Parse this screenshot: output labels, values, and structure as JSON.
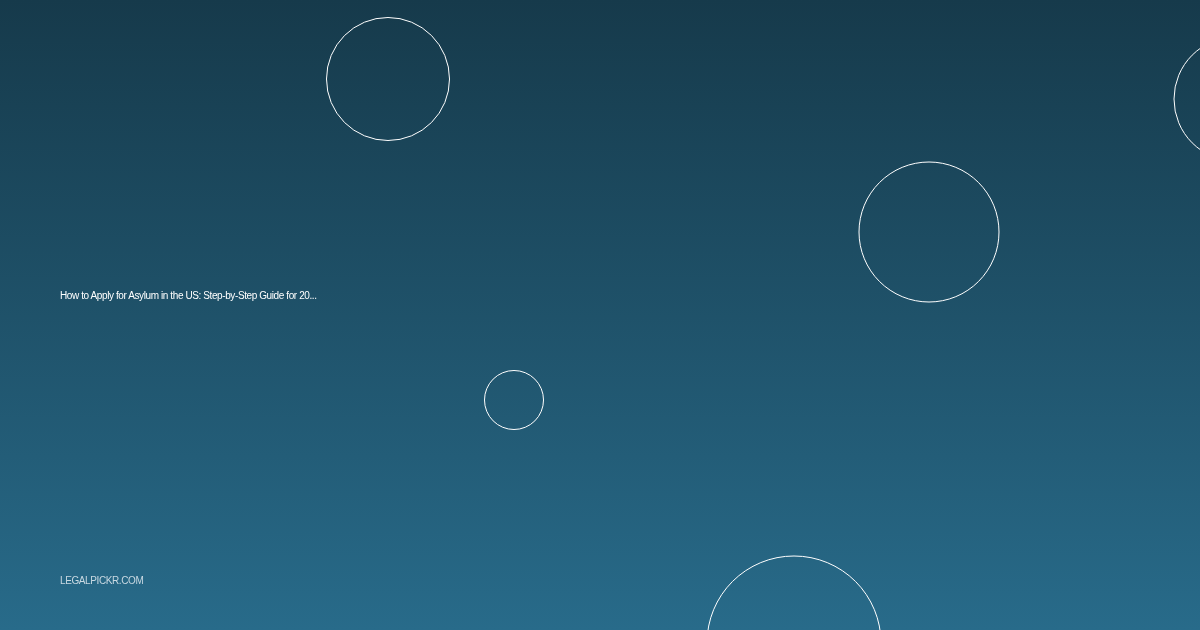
{
  "title": "How to Apply for Asylum in the US: Step-by-Step Guide for 20...",
  "site": "LEGALPICKR.COM"
}
